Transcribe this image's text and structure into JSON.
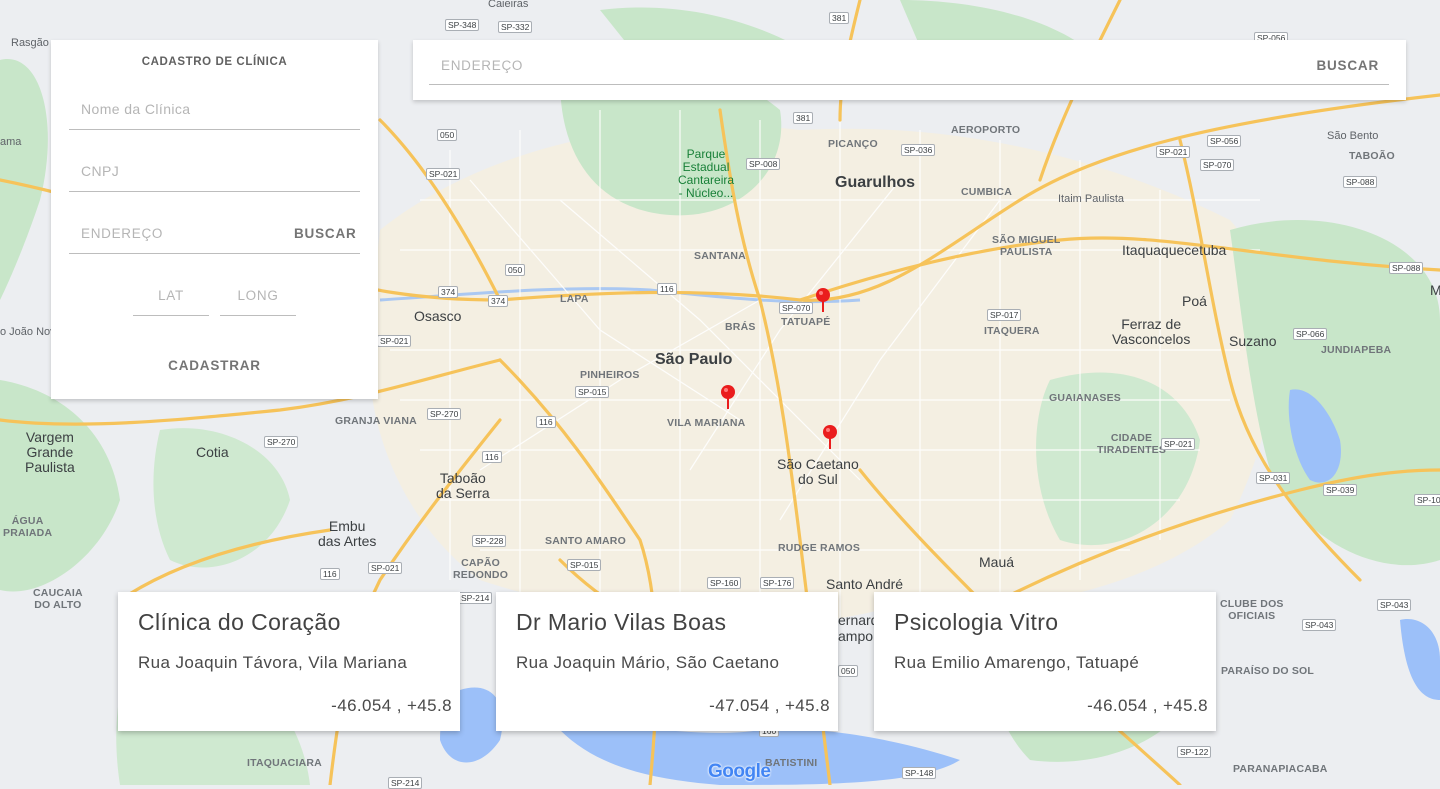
{
  "form": {
    "title": "CADASTRO DE CLÍNICA",
    "name_placeholder": "Nome da Clínica",
    "cnpj_placeholder": "CNPJ",
    "address_placeholder": "ENDEREÇO",
    "search_label": "BUSCAR",
    "lat_placeholder": "LAT",
    "long_placeholder": "LONG",
    "submit_label": "CADASTRAR"
  },
  "search_bar": {
    "placeholder": "ENDEREÇO",
    "button_label": "BUSCAR"
  },
  "clinics": [
    {
      "name": "Clínica do Coração",
      "address": "Rua Joaquin Távora, Vila Mariana",
      "coords": "-46.054 , +45.8"
    },
    {
      "name": "Dr Mario Vilas Boas",
      "address": "Rua Joaquin Mário, São Caetano",
      "coords": "-47.054 , +45.8"
    },
    {
      "name": "Psicologia Vitro",
      "address": "Rua Emilio Amarengo, Tatuapé",
      "coords": "-46.054 , +45.8"
    }
  ],
  "map": {
    "attribution": "Google",
    "colors": {
      "land": "#eceef1",
      "park": "#c5e8c5",
      "water": "#9cc0f9",
      "highway": "#fbd46b",
      "urban": "#f8f1dd",
      "pin": "#ea1d1d"
    },
    "labels": {
      "caieiras": "Caieiras",
      "rasgao": "Rasgão",
      "ama": "ama",
      "sao_joao_novo": "o João Novo",
      "parque": "Parque\nEstadual\nCantareira\n- Núcleo...",
      "picanco": "PICANÇO",
      "aeroporto": "AEROPORTO",
      "guarulhos": "Guarulhos",
      "cumbica": "CUMBICA",
      "itaim_paulista": "Itaim Paulista",
      "sao_bento": "São Bento",
      "taboao_n": "TABOÃO",
      "santana": "SANTANA",
      "sao_miguel": "SÃO MIGUEL\nPAULISTA",
      "itaquaquecetuba": "Itaquaquecetuba",
      "lapa": "LAPA",
      "tatuape": "TATUAPÉ",
      "bras": "BRÁS",
      "osasco": "Osasco",
      "poa": "Poá",
      "ferraz": "Ferraz de\nVasconcelos",
      "itaquera": "ITAQUERA",
      "suzano": "Suzano",
      "jundiapeba": "JUNDIAPEBA",
      "sao_paulo": "São Paulo",
      "pinheiros": "PINHEIROS",
      "guaianases": "GUAIANASES",
      "cidade_tiradentes": "CIDADE\nTIRADENTES",
      "vila_mariana": "VILA MARIANA",
      "granja_viana": "GRANJA VIANA",
      "vargem": "Vargem\nGrande\nPaulista",
      "cotia": "Cotia",
      "sao_caetano": "São Caetano\ndo Sul",
      "taboao_serra": "Taboão\nda Serra",
      "agua_praiada": "ÁGUA\nPRAIADA",
      "embu": "Embu\ndas Artes",
      "santo_amaro": "SANTO AMARO",
      "rudge_ramos": "RUDGE RAMOS",
      "maua": "Mauá",
      "capao_redondo": "CAPÃO\nREDONDO",
      "caucaia": "CAUCAIA\nDO ALTO",
      "santo_andre": "Santo André",
      "clube_oficiais": "CLUBE DOS\nOFICIAIS",
      "paraiso_sol": "PARAÍSO DO SOL",
      "itaquaciara": "ITAQUACIARA",
      "batistini": "BATISTINI",
      "paranapiacaba": "PARANAPIACABA",
      "nernard": "ernard",
      "rampo": "ampo",
      "m_edge": "M"
    },
    "shields": [
      "SP-348",
      "SP-332",
      "381",
      "SP-056",
      "050",
      "381",
      "SP-021",
      "SP-008",
      "SP-036",
      "SP-021",
      "SP-056",
      "SP-070",
      "SP-088",
      "050",
      "374",
      "374",
      "116",
      "SP-070",
      "SP-017",
      "SP-088",
      "SP-066",
      "SP-021",
      "SP-015",
      "SP-270",
      "116",
      "116",
      "SP-270",
      "SP-021",
      "SP-031",
      "SP-039",
      "SP-10",
      "SP-228",
      "SP-015",
      "SP-160",
      "SP-176",
      "116",
      "SP-021",
      "SP-214",
      "SP-043",
      "SP-043",
      "050",
      "160",
      "SP-122",
      "SP-148",
      "SP-214"
    ]
  }
}
